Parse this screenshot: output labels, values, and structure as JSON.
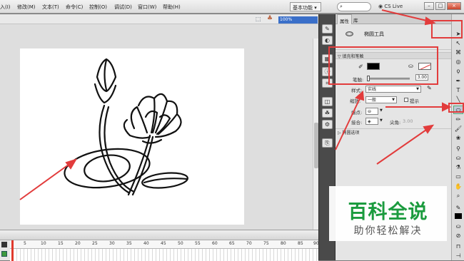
{
  "menu": {
    "items": [
      "入(I)",
      "修改(M)",
      "文本(T)",
      "命令(C)",
      "控制(O)",
      "调试(D)",
      "窗口(W)",
      "帮助(H)"
    ],
    "workspace": "基本功能",
    "cs_live": "CS Live"
  },
  "stage": {
    "zoom": "100%"
  },
  "timeline": {
    "frame_numbers": [
      "5",
      "10",
      "15",
      "20",
      "25",
      "30",
      "35",
      "40",
      "45",
      "50",
      "55",
      "60",
      "65",
      "70",
      "75",
      "80",
      "85",
      "90"
    ]
  },
  "properties": {
    "tabs": [
      "属性",
      "库"
    ],
    "tool_name": "椭圆工具",
    "fill_stroke_section": "填充和笔触",
    "stroke_label": "笔触:",
    "stroke_value": "3.00",
    "style_label": "样式:",
    "style_value": "实线",
    "scale_label": "缩放:",
    "scale_value": "一般",
    "hint_label": "提示",
    "cap_label": "端点:",
    "join_label": "接合:",
    "miter_label": "尖角:",
    "miter_value": "3.00",
    "ellipse_options": "椭圆选项"
  },
  "colors": {
    "highlight": "#e23c3c",
    "stroke": "#000000",
    "watermark_green": "#1b9b3e"
  },
  "watermark": {
    "title": "百科全说",
    "subtitle": "助你轻松解决"
  }
}
